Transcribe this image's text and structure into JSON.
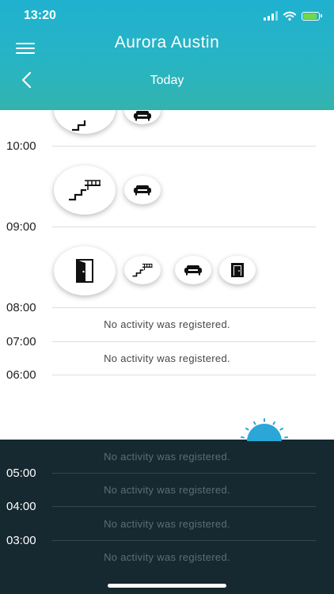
{
  "status_bar": {
    "time": "13:20"
  },
  "header": {
    "title": "Aurora Austin",
    "day": "Today"
  },
  "timeline": {
    "hours": {
      "h10": "10:00",
      "h09": "09:00",
      "h08": "08:00",
      "h07": "07:00",
      "h06": "06:00"
    },
    "empty_message": "No activity was registered.",
    "activities": {
      "row_top": [
        "stairs-icon",
        "sofa-icon"
      ],
      "row_9": [
        "stairs-icon",
        "sofa-icon"
      ],
      "row_8": [
        "door-icon",
        "stairs-icon",
        "sofa-icon",
        "door-icon"
      ]
    }
  },
  "night": {
    "hours": {
      "h05": "05:00",
      "h04": "04:00",
      "h03": "03:00"
    },
    "empty_message": "No activity was registered."
  },
  "colors": {
    "header_top": "#1fb1cf",
    "header_bottom": "#33b3ad",
    "night_bg": "#162830",
    "sun": "#2aa7d6"
  }
}
